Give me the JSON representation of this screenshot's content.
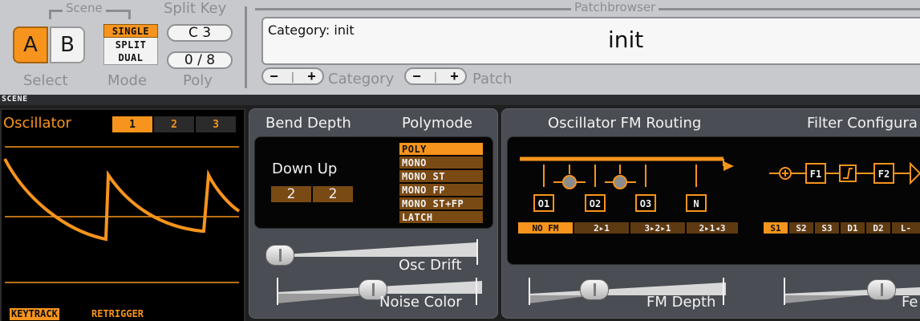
{
  "header": {
    "scene_title": "Scene",
    "scene_a": "A",
    "scene_b": "B",
    "select_label": "Select",
    "mode_options": [
      "SINGLE",
      "SPLIT",
      "DUAL"
    ],
    "mode_selected": "SINGLE",
    "mode_label": "Mode",
    "split_key_title": "Split Key",
    "split_key_value": "C 3",
    "poly_value": "0 / 8",
    "poly_label": "Poly",
    "patchbrowser_title": "Patchbrowser",
    "category_text": "Category: init",
    "patch_name": "init",
    "category_label": "Category",
    "patch_label": "Patch",
    "minus": "−",
    "plus": "+"
  },
  "scene_strip_label": "SCENE",
  "oscillator": {
    "title": "Oscillator",
    "tabs": [
      "1",
      "2",
      "3"
    ],
    "active_tab": "1",
    "keytrack_label": "KEYTRACK",
    "retrigger_label": "RETRIGGER"
  },
  "bend": {
    "title": "Bend Depth",
    "down_up_label": "Down Up",
    "down_value": "2",
    "up_value": "2"
  },
  "polymode": {
    "title": "Polymode",
    "options": [
      "POLY",
      "MONO",
      "MONO ST",
      "MONO FP",
      "MONO ST+FP",
      "LATCH"
    ],
    "selected": "POLY"
  },
  "sliders": {
    "osc_drift": "Osc Drift",
    "noise_color": "Noise Color",
    "fm_depth": "FM Depth",
    "feedback": "Fe"
  },
  "fm_routing": {
    "title": "Oscillator FM Routing",
    "osc_labels": [
      "O1",
      "O2",
      "O3",
      "N"
    ],
    "tabs": [
      "NO FM",
      "2▸1",
      "3▸2▸1",
      "2▸1◂3"
    ],
    "active_tab": "NO FM"
  },
  "filter_config": {
    "title": "Filter Configura",
    "filter_labels": [
      "F1",
      "F2"
    ],
    "tabs": [
      "S1",
      "S2",
      "S3",
      "D1",
      "D2",
      "L-"
    ],
    "active_tab": "S1"
  },
  "colors": {
    "accent": "#f7941d",
    "panel": "#4a4d53",
    "header": "#c7c9cc"
  }
}
